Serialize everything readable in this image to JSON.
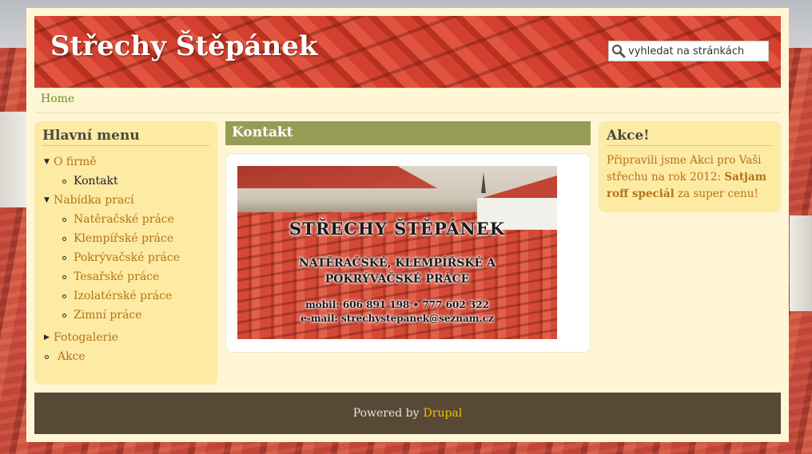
{
  "site": {
    "name": "Střechy Štěpánek"
  },
  "search": {
    "placeholder": "vyhledat na stránkách"
  },
  "breadcrumb": {
    "home": "Home"
  },
  "main_menu": {
    "title": "Hlavní menu",
    "items": [
      {
        "label": "O firmě",
        "expanded": true,
        "children": [
          {
            "label": "Kontakt",
            "active": true
          }
        ]
      },
      {
        "label": "Nabídka prací",
        "expanded": true,
        "children": [
          {
            "label": "Natěračské práce"
          },
          {
            "label": "Klempířské práce"
          },
          {
            "label": "Pokrývačské práce"
          },
          {
            "label": "Tesařské práce"
          },
          {
            "label": "Izolatérské práce"
          },
          {
            "label": "Zimní práce"
          }
        ]
      },
      {
        "label": "Fotogalerie",
        "expanded": false
      },
      {
        "label": "Akce"
      }
    ]
  },
  "content": {
    "title": "Kontakt",
    "banner": {
      "line1": "STŘECHY ŠTĚPÁNEK",
      "line2": "NATĚRAČSKÉ, KLEMPÍŘSKÉ A POKRÝVAČSKÉ PRÁCE",
      "line3": "mobil: 606 891 198 • 777 602 322",
      "line4": "e-mail: strechystepanek@seznam.cz"
    }
  },
  "akce_block": {
    "title": "Akce!",
    "text_before": "Připravili jsme Akci pro Vaši střechu na rok 2012: ",
    "highlight": "Satjam roff speciál",
    "text_after": " za super cenu!"
  },
  "footer": {
    "powered_by": "Powered by",
    "link": "Drupal"
  },
  "colors": {
    "page_bg": "#fff6d6",
    "sidebar_bg": "#fdeaa3",
    "title_bar": "#979c55",
    "footer_bg": "#584936",
    "link": "#b3731a",
    "footer_link": "#f2c000"
  },
  "icons": {
    "search": "search-icon"
  }
}
